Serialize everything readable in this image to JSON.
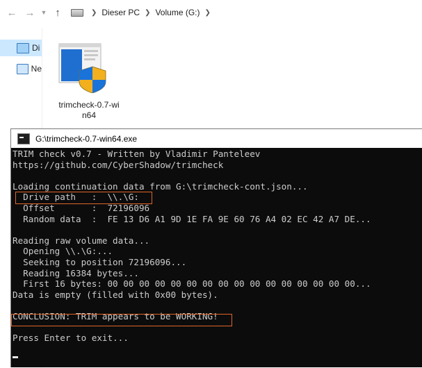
{
  "explorer": {
    "breadcrumb": [
      "Dieser PC",
      "Volume (G:)"
    ],
    "sidebar": [
      {
        "label": "Di",
        "icon": "computer-icon",
        "selected": true
      },
      {
        "label": "Ne",
        "icon": "network-icon",
        "selected": false
      }
    ],
    "file": {
      "name": "trimcheck-0.7-win64",
      "label_line1": "trimcheck-0.7-wi",
      "label_line2": "n64"
    }
  },
  "console": {
    "title": "G:\\trimcheck-0.7-win64.exe",
    "lines": [
      "TRIM check v0.7 - Written by Vladimir Panteleev",
      "https://github.com/CyberShadow/trimcheck",
      "",
      "Loading continuation data from G:\\trimcheck-cont.json...",
      "  Drive path   :  \\\\.\\G:",
      "  Offset       :  72196096",
      "  Random data  :  FE 13 D6 A1 9D 1E FA 9E 60 76 A4 02 EC 42 A7 DE...",
      "",
      "Reading raw volume data...",
      "  Opening \\\\.\\G:...",
      "  Seeking to position 72196096...",
      "  Reading 16384 bytes...",
      "  First 16 bytes: 00 00 00 00 00 00 00 00 00 00 00 00 00 00 00 00...",
      "Data is empty (filled with 0x00 bytes).",
      "",
      "CONCLUSION: TRIM appears to be WORKING!",
      "",
      "Press Enter to exit..."
    ]
  }
}
